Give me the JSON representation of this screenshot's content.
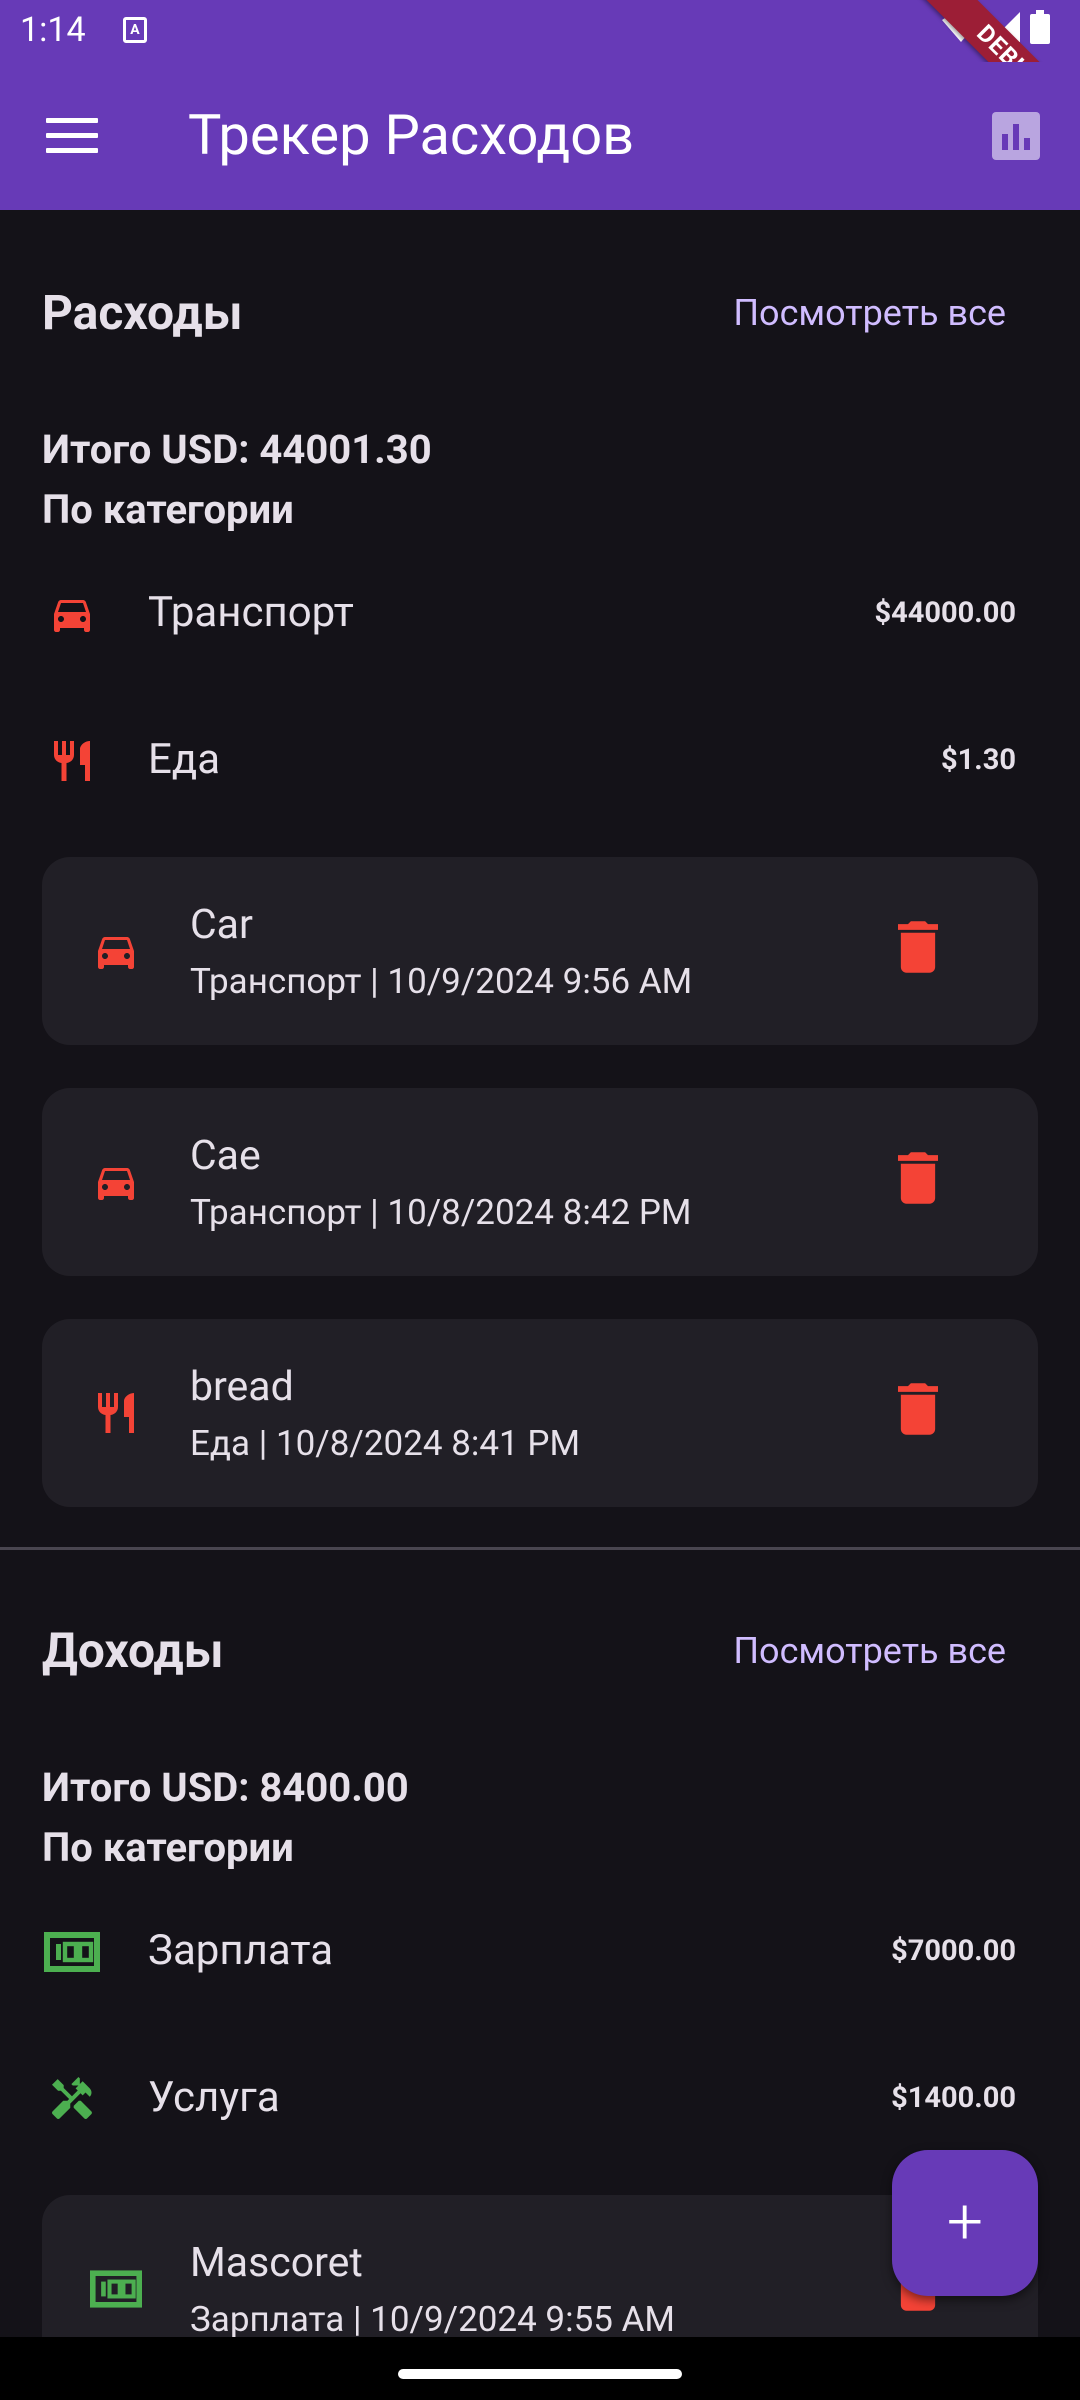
{
  "status": {
    "time": "1:14",
    "badge": "A"
  },
  "debug_label": "DEBUG",
  "app_bar": {
    "title": "Трекер Расходов"
  },
  "expenses": {
    "title": "Расходы",
    "view_all": "Посмотреть все",
    "total": "Итого USD: 44001.30",
    "by_category": "По категории",
    "categories": [
      {
        "name": "Транспорт",
        "amount": "$44000.00",
        "icon": "car-icon"
      },
      {
        "name": "Еда",
        "amount": "$1.30",
        "icon": "restaurant-icon"
      }
    ],
    "items": [
      {
        "title": "Car",
        "subtitle": "Транспорт | 10/9/2024 9:56 AM",
        "icon": "car-icon"
      },
      {
        "title": "Cae",
        "subtitle": "Транспорт | 10/8/2024 8:42 PM",
        "icon": "car-icon"
      },
      {
        "title": "bread",
        "subtitle": "Еда | 10/8/2024 8:41 PM",
        "icon": "restaurant-icon"
      }
    ]
  },
  "incomes": {
    "title": "Доходы",
    "view_all": "Посмотреть все",
    "total": "Итого USD: 8400.00",
    "by_category": "По категории",
    "categories": [
      {
        "name": "Зарплата",
        "amount": "$7000.00",
        "icon": "money-icon"
      },
      {
        "name": "Услуга",
        "amount": "$1400.00",
        "icon": "tools-icon"
      }
    ],
    "items": [
      {
        "title": "Mascoret",
        "subtitle": "Зарплата | 10/9/2024 9:55 AM",
        "icon": "money-icon"
      }
    ]
  },
  "fab": {
    "label": "+"
  },
  "colors": {
    "primary": "#673ab7",
    "expense": "#f44336",
    "income": "#4caf50",
    "link": "#d0bcff",
    "background": "#141218",
    "card": "#211f26"
  }
}
